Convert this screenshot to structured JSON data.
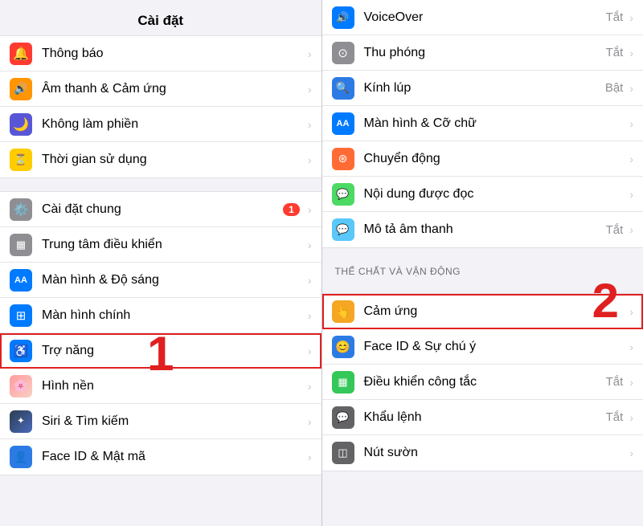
{
  "left_panel": {
    "header": "Cài đặt",
    "number_label": "1",
    "groups": [
      {
        "items": [
          {
            "id": "thong-bao",
            "icon_bg": "icon-red",
            "icon": "🔔",
            "label": "Thông báo",
            "value": "",
            "badge": ""
          },
          {
            "id": "am-thanh",
            "icon_bg": "icon-orange",
            "icon": "🔊",
            "label": "Âm thanh & Cảm ứng",
            "value": "",
            "badge": ""
          },
          {
            "id": "khong-lam-phien",
            "icon_bg": "icon-moon",
            "icon": "🌙",
            "label": "Không làm phiền",
            "value": "",
            "badge": ""
          },
          {
            "id": "thoi-gian-su-dung",
            "icon_bg": "icon-yellow",
            "icon": "⏳",
            "label": "Thời gian sử dụng",
            "value": "",
            "badge": ""
          }
        ]
      },
      {
        "items": [
          {
            "id": "cai-dat-chung",
            "icon_bg": "icon-gray",
            "icon": "⚙️",
            "label": "Cài đặt chung",
            "value": "",
            "badge": "1"
          },
          {
            "id": "trung-tam-dieu-khien",
            "icon_bg": "icon-gray",
            "icon": "🔳",
            "label": "Trung tâm điều khiển",
            "value": "",
            "badge": ""
          },
          {
            "id": "man-hinh-do-sang",
            "icon_bg": "icon-blue",
            "icon": "AA",
            "label": "Màn hình & Độ sáng",
            "value": "",
            "badge": ""
          },
          {
            "id": "man-hinh-chinh",
            "icon_bg": "icon-blue",
            "icon": "⊞",
            "label": "Màn hình chính",
            "value": "",
            "badge": ""
          },
          {
            "id": "tro-nang",
            "icon_bg": "icon-accessibility",
            "icon": "♿",
            "label": "Trợ năng",
            "value": "",
            "badge": "",
            "highlighted": true
          },
          {
            "id": "hinh-nen",
            "icon_bg": "icon-wallpaper",
            "icon": "🌸",
            "label": "Hình nền",
            "value": "",
            "badge": ""
          },
          {
            "id": "siri-tim-kiem",
            "icon_bg": "icon-siri",
            "icon": "✦",
            "label": "Siri & Tìm kiếm",
            "value": "",
            "badge": ""
          },
          {
            "id": "face-id-mat-ma",
            "icon_bg": "icon-faceid",
            "icon": "👤",
            "label": "Face ID & Mật mã",
            "value": "",
            "badge": ""
          }
        ]
      }
    ]
  },
  "right_panel": {
    "number_label": "2",
    "groups": [
      {
        "items": [
          {
            "id": "voiceover",
            "icon_bg": "icon-blue",
            "icon": "🔊",
            "label": "VoiceOver",
            "value": "Tắt"
          },
          {
            "id": "thu-phong",
            "icon_bg": "icon-gray",
            "icon": "⊙",
            "label": "Thu phóng",
            "value": "Tắt"
          },
          {
            "id": "kinh-lup",
            "icon_bg": "icon-lens",
            "icon": "🔍",
            "label": "Kính lúp",
            "value": "Bật"
          },
          {
            "id": "man-hinh-co-chu",
            "icon_bg": "icon-display",
            "icon": "AA",
            "label": "Màn hình & Cỡ chữ",
            "value": ""
          },
          {
            "id": "chuyen-dong",
            "icon_bg": "icon-motion",
            "icon": "⊛",
            "label": "Chuyển động",
            "value": ""
          },
          {
            "id": "noi-dung-duoc-doc",
            "icon_bg": "icon-spoken",
            "icon": "💬",
            "label": "Nội dung được đọc",
            "value": ""
          },
          {
            "id": "mo-ta-am-thanh",
            "icon_bg": "icon-sub",
            "icon": "💬",
            "label": "Mô tả âm thanh",
            "value": "Tắt"
          }
        ]
      },
      {
        "section_label": "THỂ CHẤT VÀ VẬN ĐỘNG",
        "items": [
          {
            "id": "cam-ung",
            "icon_bg": "icon-touch-yellow",
            "icon": "👆",
            "label": "Cảm ứng",
            "value": "",
            "highlighted": true
          },
          {
            "id": "face-id-su-chu-y",
            "icon_bg": "icon-faceid",
            "icon": "😊",
            "label": "Face ID & Sự chú ý",
            "value": ""
          },
          {
            "id": "dieu-khien-cong-tac",
            "icon_bg": "icon-switch",
            "icon": "⊞",
            "label": "Điều khiển công tắc",
            "value": "Tắt"
          },
          {
            "id": "khau-lenh",
            "icon_bg": "icon-cmd",
            "icon": "💬",
            "label": "Khẩu lệnh",
            "value": "Tắt"
          },
          {
            "id": "nut-suon",
            "icon_bg": "icon-nut",
            "icon": "◫",
            "label": "Nút sườn",
            "value": ""
          }
        ]
      }
    ]
  }
}
